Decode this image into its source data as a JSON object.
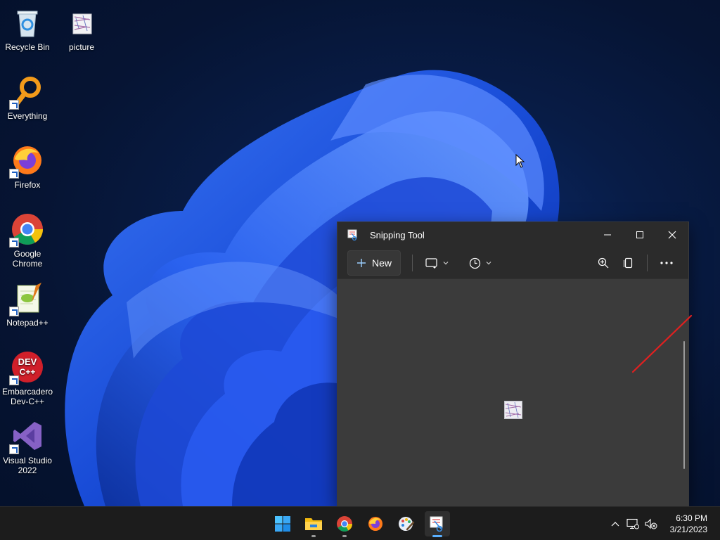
{
  "desktop": {
    "icons": [
      {
        "label": "Recycle Bin",
        "icon": "recycle-bin-icon"
      },
      {
        "label": "picture",
        "icon": "image-file-icon"
      },
      {
        "label": "Everything",
        "icon": "everything-search-icon"
      },
      {
        "label": "Firefox",
        "icon": "firefox-icon"
      },
      {
        "label": "Google Chrome",
        "icon": "chrome-icon"
      },
      {
        "label": "Notepad++",
        "icon": "notepadpp-icon"
      },
      {
        "label": "Embarcadero Dev-C++",
        "icon": "devcpp-icon"
      },
      {
        "label": "Visual Studio 2022",
        "icon": "visual-studio-icon"
      }
    ],
    "devcpp_badge_top": "DEV",
    "devcpp_badge_bottom": "C++"
  },
  "window": {
    "title": "Snipping Tool",
    "new_label": "New",
    "buttons": [
      "minimize",
      "maximize",
      "close"
    ],
    "toolbar_icons": [
      "snip-mode-icon",
      "delay-timer-icon",
      "zoom-in-icon",
      "copy-icon",
      "more-options-icon"
    ]
  },
  "taskbar": {
    "pinned": [
      "start-icon",
      "file-explorer-icon",
      "chrome-icon",
      "firefox-icon",
      "paint-icon",
      "snipping-tool-icon"
    ],
    "active": "snipping-tool-icon",
    "time": "6:30 PM",
    "date": "3/21/2023"
  },
  "colors": {
    "accent": "#5ab0ff",
    "window_bg": "#2b2b2b",
    "canvas_bg": "#3b3b3b",
    "taskbar_bg": "#1c1c1c",
    "ink": "#e02020"
  }
}
